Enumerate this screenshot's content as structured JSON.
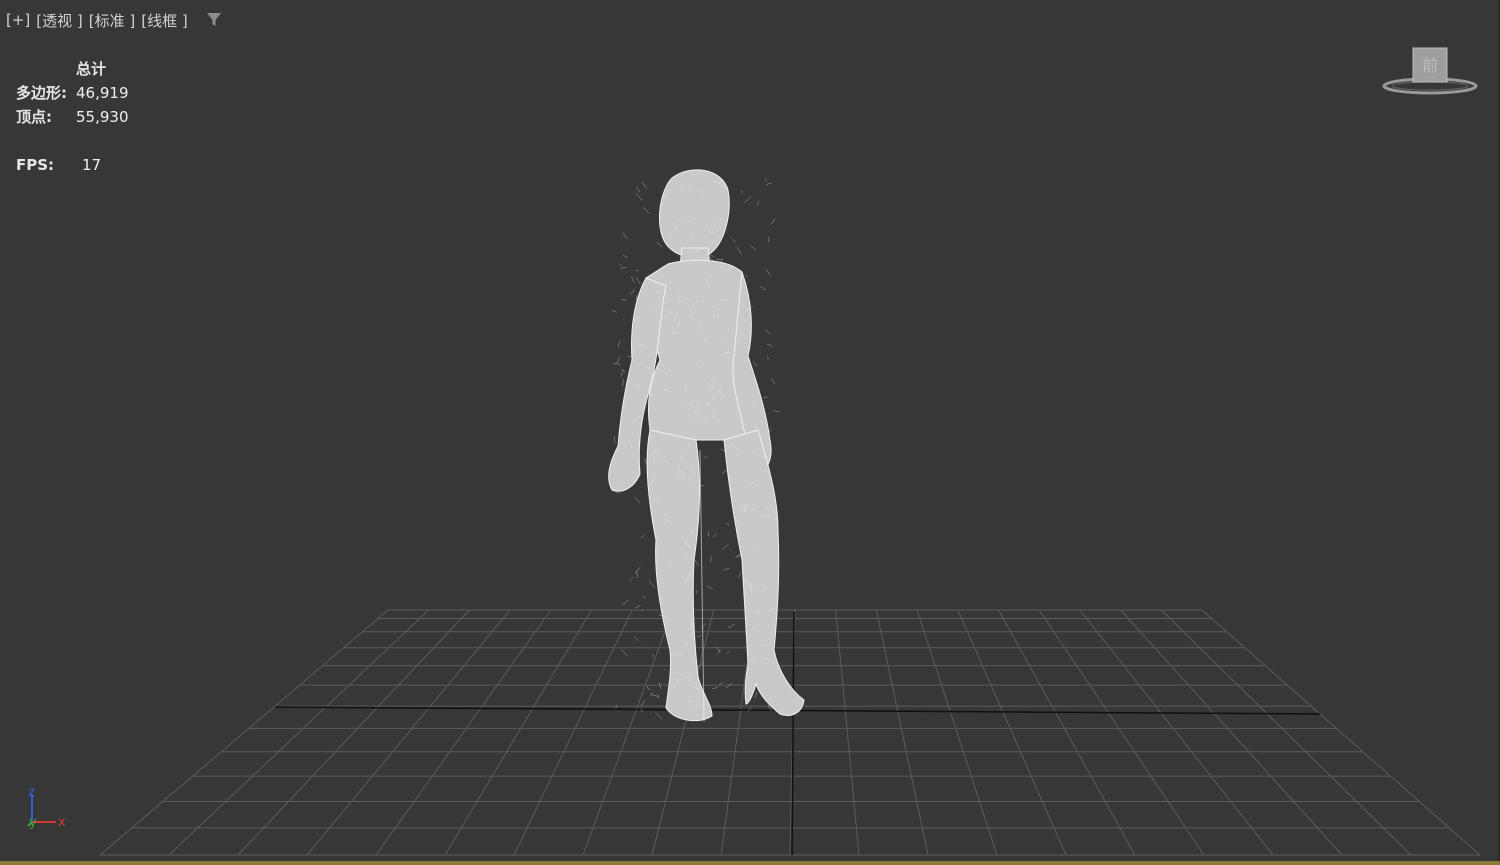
{
  "viewport": {
    "labels": [
      "[+]",
      "[透视 ]",
      "[标准 ]",
      "[线框 ]"
    ],
    "filter_icon": "filter-icon"
  },
  "stats": {
    "heading": "总计",
    "polygons_label": "多边形:",
    "polygons_value": "46,919",
    "vertices_label": "顶点:",
    "vertices_value": "55,930",
    "fps_label": "FPS:",
    "fps_value": "17"
  },
  "viewcube": {
    "face_label": "前"
  },
  "axis_tripod": {
    "z": "z",
    "y": "y",
    "x": "x",
    "colors": {
      "x": "#d23a3a",
      "y": "#3aa53a",
      "z": "#3a5ed2"
    }
  },
  "colors": {
    "background": "#373737",
    "grid": "#5c5c5c",
    "grid_axis": "#0f0f0f",
    "wireframe": "#e8e8e8"
  }
}
